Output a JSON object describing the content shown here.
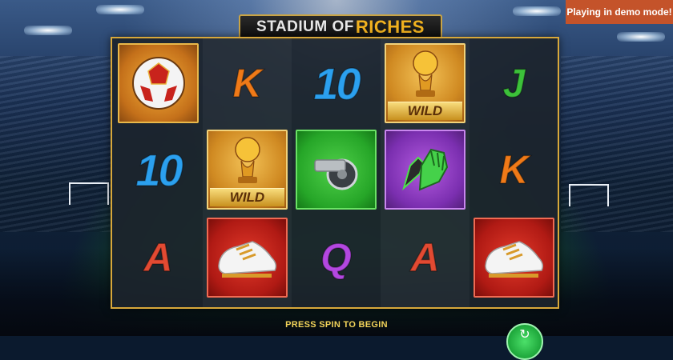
{
  "game": {
    "title_part1": "STADIUM OF",
    "title_part2": "RICHES",
    "demo_notice": "Playing in demo mode!",
    "prompt": "PRESS SPIN TO BEGIN",
    "wild_label": "WILD"
  },
  "colors": {
    "gold": "#d8a83a",
    "K": "#f07a18",
    "ten": "#2ba0ef",
    "J": "#3cc13a",
    "A": "#e24a32",
    "Q": "#b347e0",
    "demo_bg": "#c4532a",
    "prompt": "#f2d35a"
  },
  "reels": [
    [
      "football-tile",
      "10",
      "A"
    ],
    [
      "K",
      "trophy-wild",
      "red-boot"
    ],
    [
      "10",
      "whistle-tile",
      "Q"
    ],
    [
      "trophy-wild",
      "gloves-tile",
      "A"
    ],
    [
      "J",
      "K",
      "red-boot"
    ]
  ],
  "symbols": {
    "K": "K",
    "J": "J",
    "A": "A",
    "Q": "Q",
    "ten": "10"
  },
  "icons": [
    "football-icon",
    "trophy-icon",
    "whistle-icon",
    "goalkeeper-gloves-icon",
    "football-boot-icon",
    "spin-arrow-icon"
  ]
}
